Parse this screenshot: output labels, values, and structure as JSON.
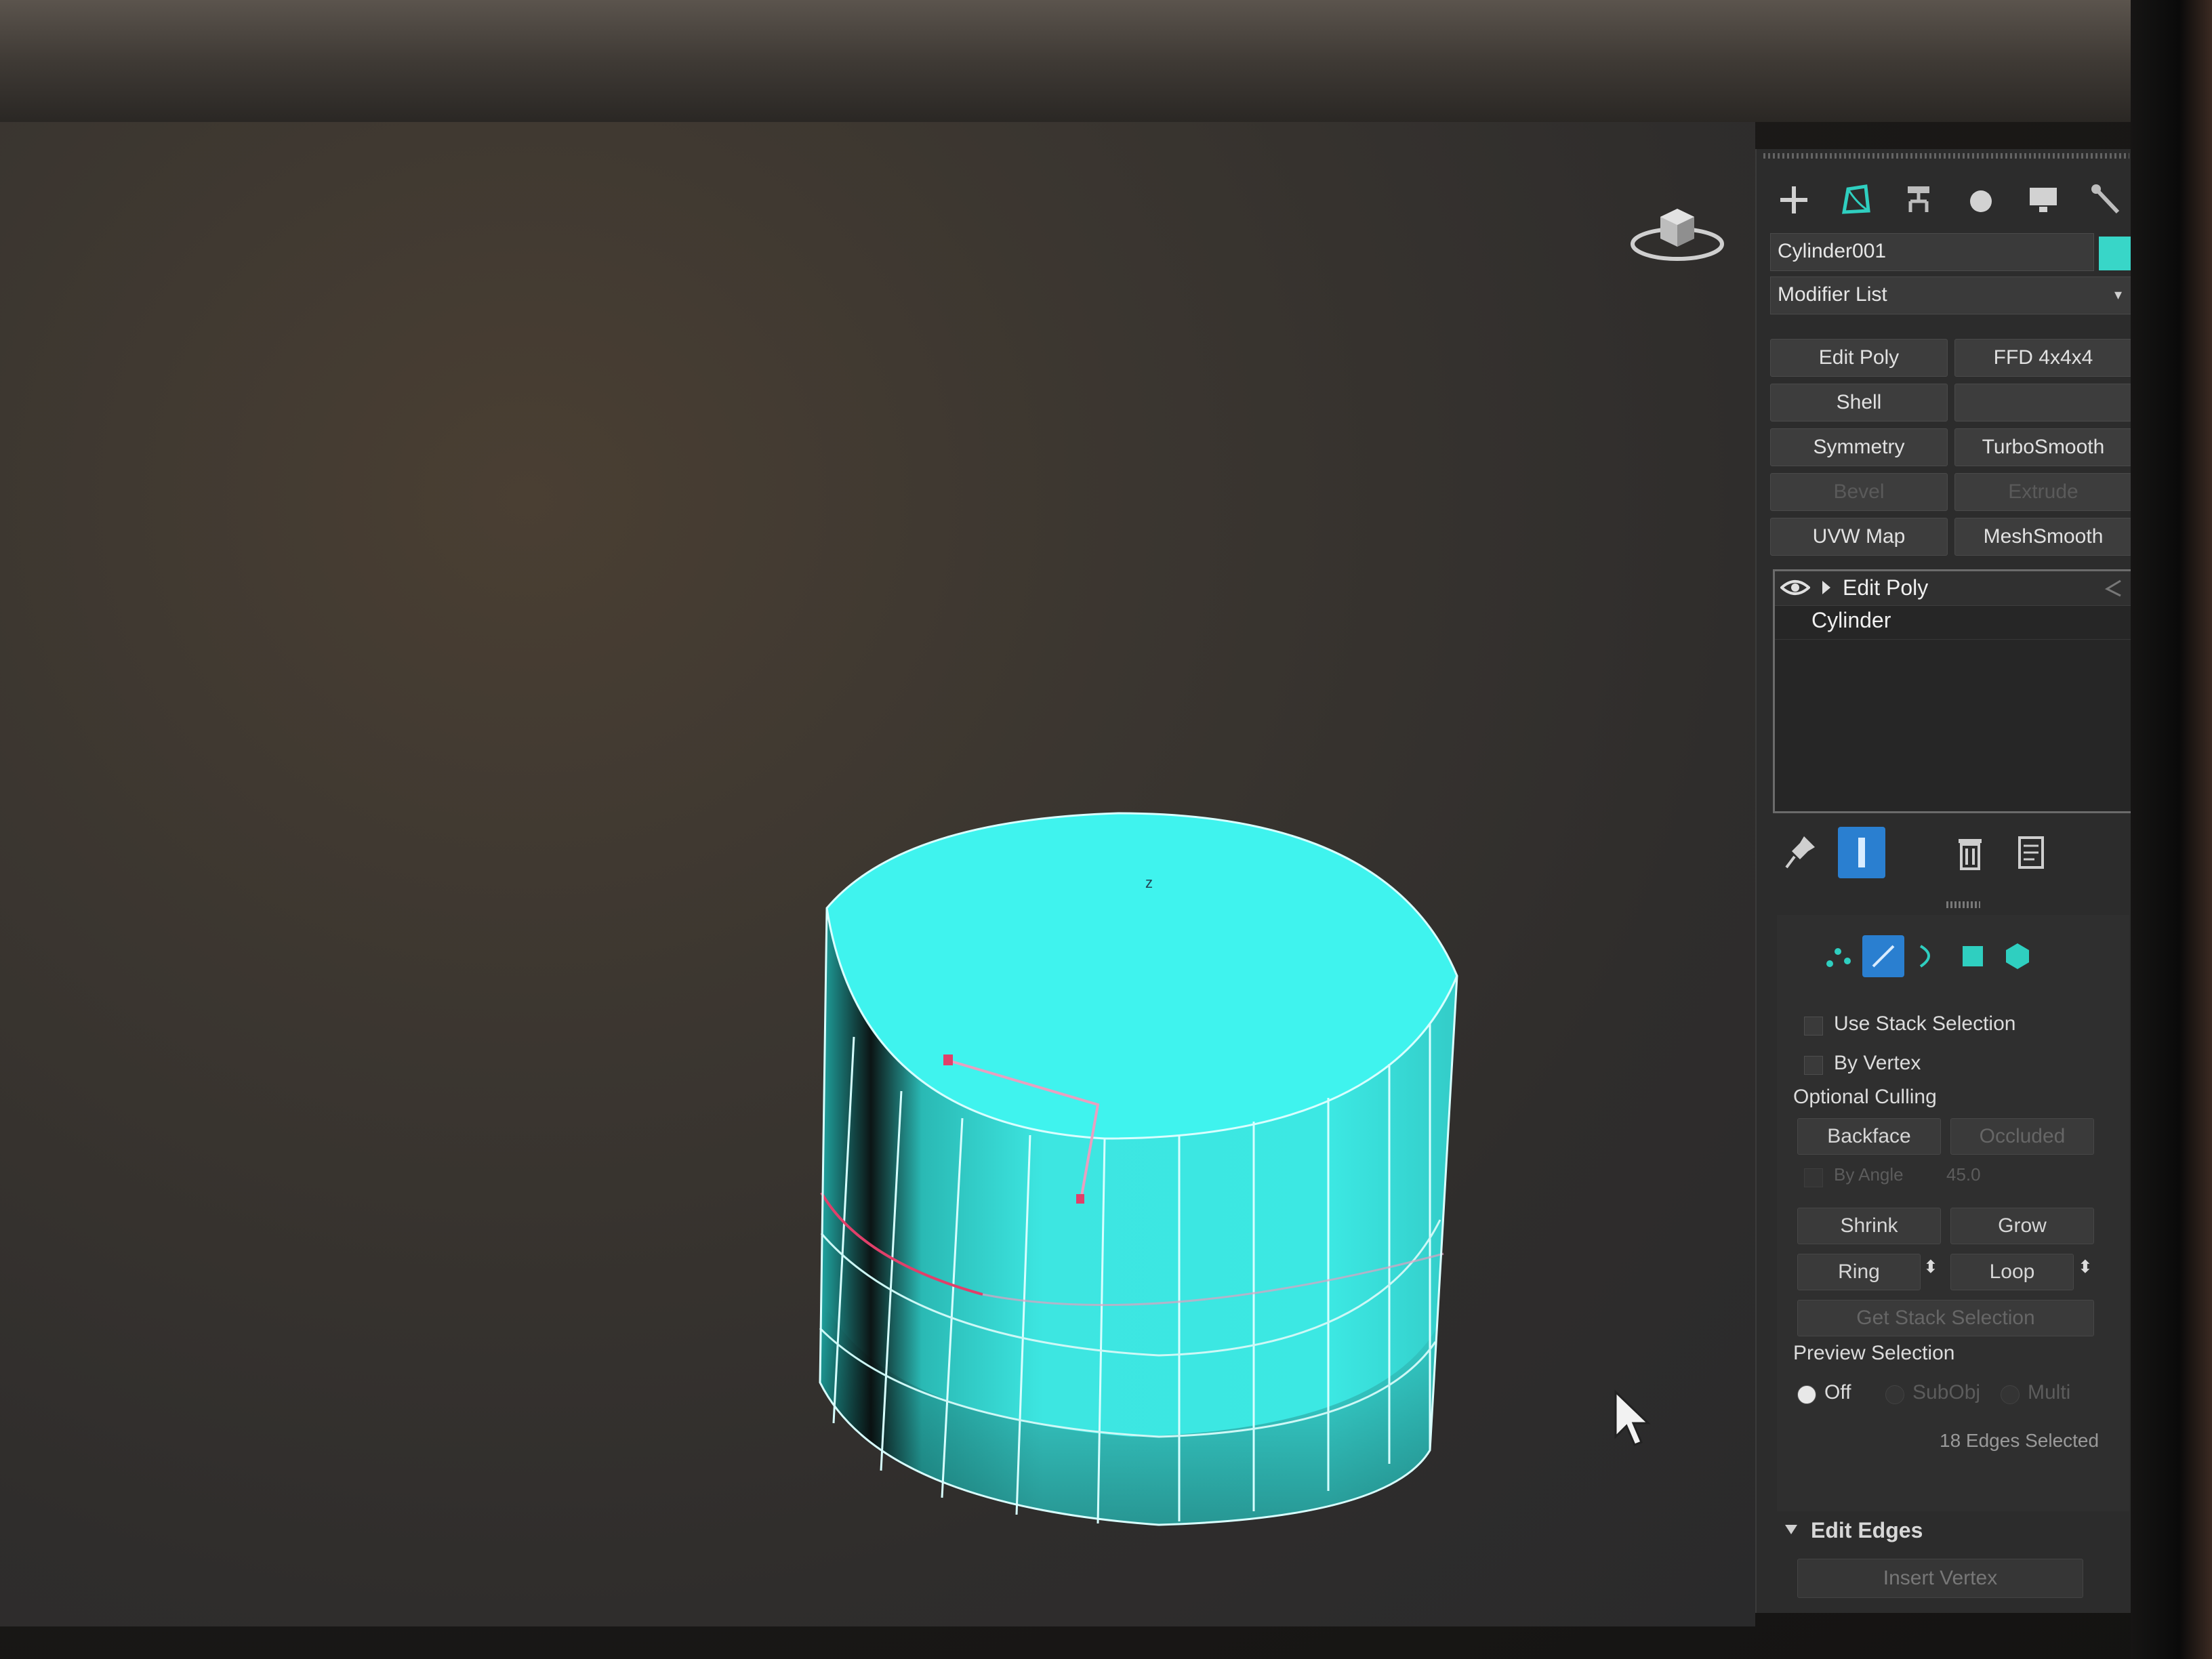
{
  "command_panel": {
    "tabs": [
      {
        "icon": "create-icon"
      },
      {
        "icon": "modify-icon"
      },
      {
        "icon": "hierarchy-icon"
      },
      {
        "icon": "motion-icon"
      },
      {
        "icon": "display-icon"
      },
      {
        "icon": "utilities-icon"
      }
    ],
    "object_name": "Cylinder001",
    "object_color": "#38d6c8",
    "modifier_list": "Modifier List",
    "modifier_buttons": [
      {
        "label": "Edit Poly",
        "enabled": true
      },
      {
        "label": "FFD 4x4x4",
        "enabled": true
      },
      {
        "label": "Shell",
        "enabled": true
      },
      {
        "label": "",
        "enabled": false
      },
      {
        "label": "Symmetry",
        "enabled": true
      },
      {
        "label": "TurboSmooth",
        "enabled": true
      },
      {
        "label": "Bevel",
        "enabled": false
      },
      {
        "label": "Extrude",
        "enabled": false
      },
      {
        "label": "UVW Map",
        "enabled": true
      },
      {
        "label": "MeshSmooth",
        "enabled": true
      }
    ],
    "modifier_stack": {
      "items": [
        "Edit Poly",
        "Cylinder"
      ]
    }
  },
  "selection": {
    "subobject_levels": [
      "vertex-icon",
      "edge-icon",
      "border-icon",
      "polygon-icon",
      "element-icon"
    ],
    "active_level": "edge-icon",
    "use_stack_selection": "Use Stack Selection",
    "by_vertex": "By Vertex",
    "optional_culling": "Optional Culling",
    "backface": "Backface",
    "occluded": "Occluded",
    "by_angle": "By Angle",
    "by_angle_value": "45.0",
    "shrink": "Shrink",
    "grow": "Grow",
    "ring": "Ring",
    "loop": "Loop",
    "get_stack_selection": "Get Stack Selection",
    "preview_selection": "Preview Selection",
    "preview_options": [
      "Off",
      "SubObj",
      "Multi"
    ],
    "preview_selected": "Off",
    "status": "18 Edges Selected"
  },
  "edit_edges": {
    "title": "Edit Edges",
    "insert_vertex": "Insert Vertex"
  },
  "viewport": {
    "object_color": "#3ff3ee",
    "selection_color": "#e0406a"
  }
}
